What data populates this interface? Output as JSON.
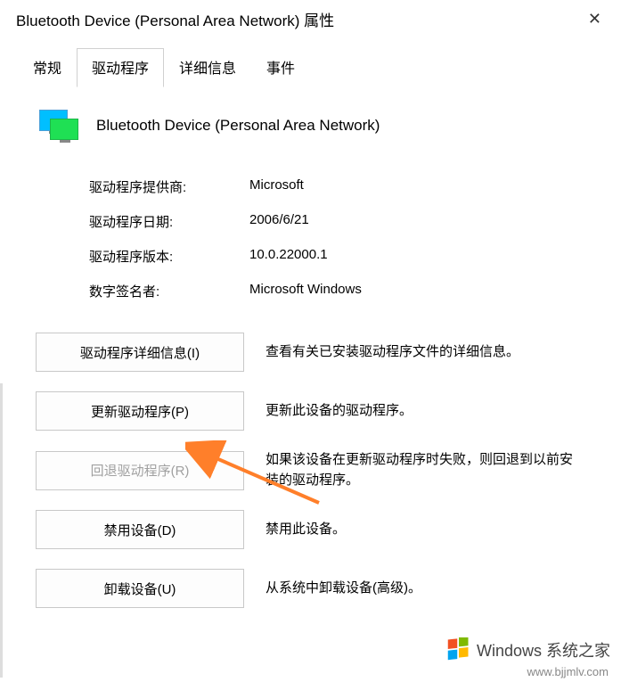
{
  "titlebar": {
    "text": "Bluetooth Device (Personal Area Network) 属性"
  },
  "tabs": {
    "items": [
      {
        "label": "常规"
      },
      {
        "label": "驱动程序"
      },
      {
        "label": "详细信息"
      },
      {
        "label": "事件"
      }
    ]
  },
  "device": {
    "name": "Bluetooth Device (Personal Area Network)"
  },
  "info": {
    "provider_label": "驱动程序提供商:",
    "provider_value": "Microsoft",
    "date_label": "驱动程序日期:",
    "date_value": "2006/6/21",
    "version_label": "驱动程序版本:",
    "version_value": "10.0.22000.1",
    "signer_label": "数字签名者:",
    "signer_value": "Microsoft Windows"
  },
  "buttons": {
    "details": {
      "label": "驱动程序详细信息(I)",
      "desc": "查看有关已安装驱动程序文件的详细信息。"
    },
    "update": {
      "label": "更新驱动程序(P)",
      "desc": "更新此设备的驱动程序。"
    },
    "rollback": {
      "label": "回退驱动程序(R)",
      "desc": "如果该设备在更新驱动程序时失败，则回退到以前安装的驱动程序。"
    },
    "disable": {
      "label": "禁用设备(D)",
      "desc": "禁用此设备。"
    },
    "uninstall": {
      "label": "卸载设备(U)",
      "desc": "从系统中卸载设备(高级)。"
    }
  },
  "watermark": {
    "brand": "Windows 系统之家",
    "url": "www.bjjmlv.com"
  }
}
